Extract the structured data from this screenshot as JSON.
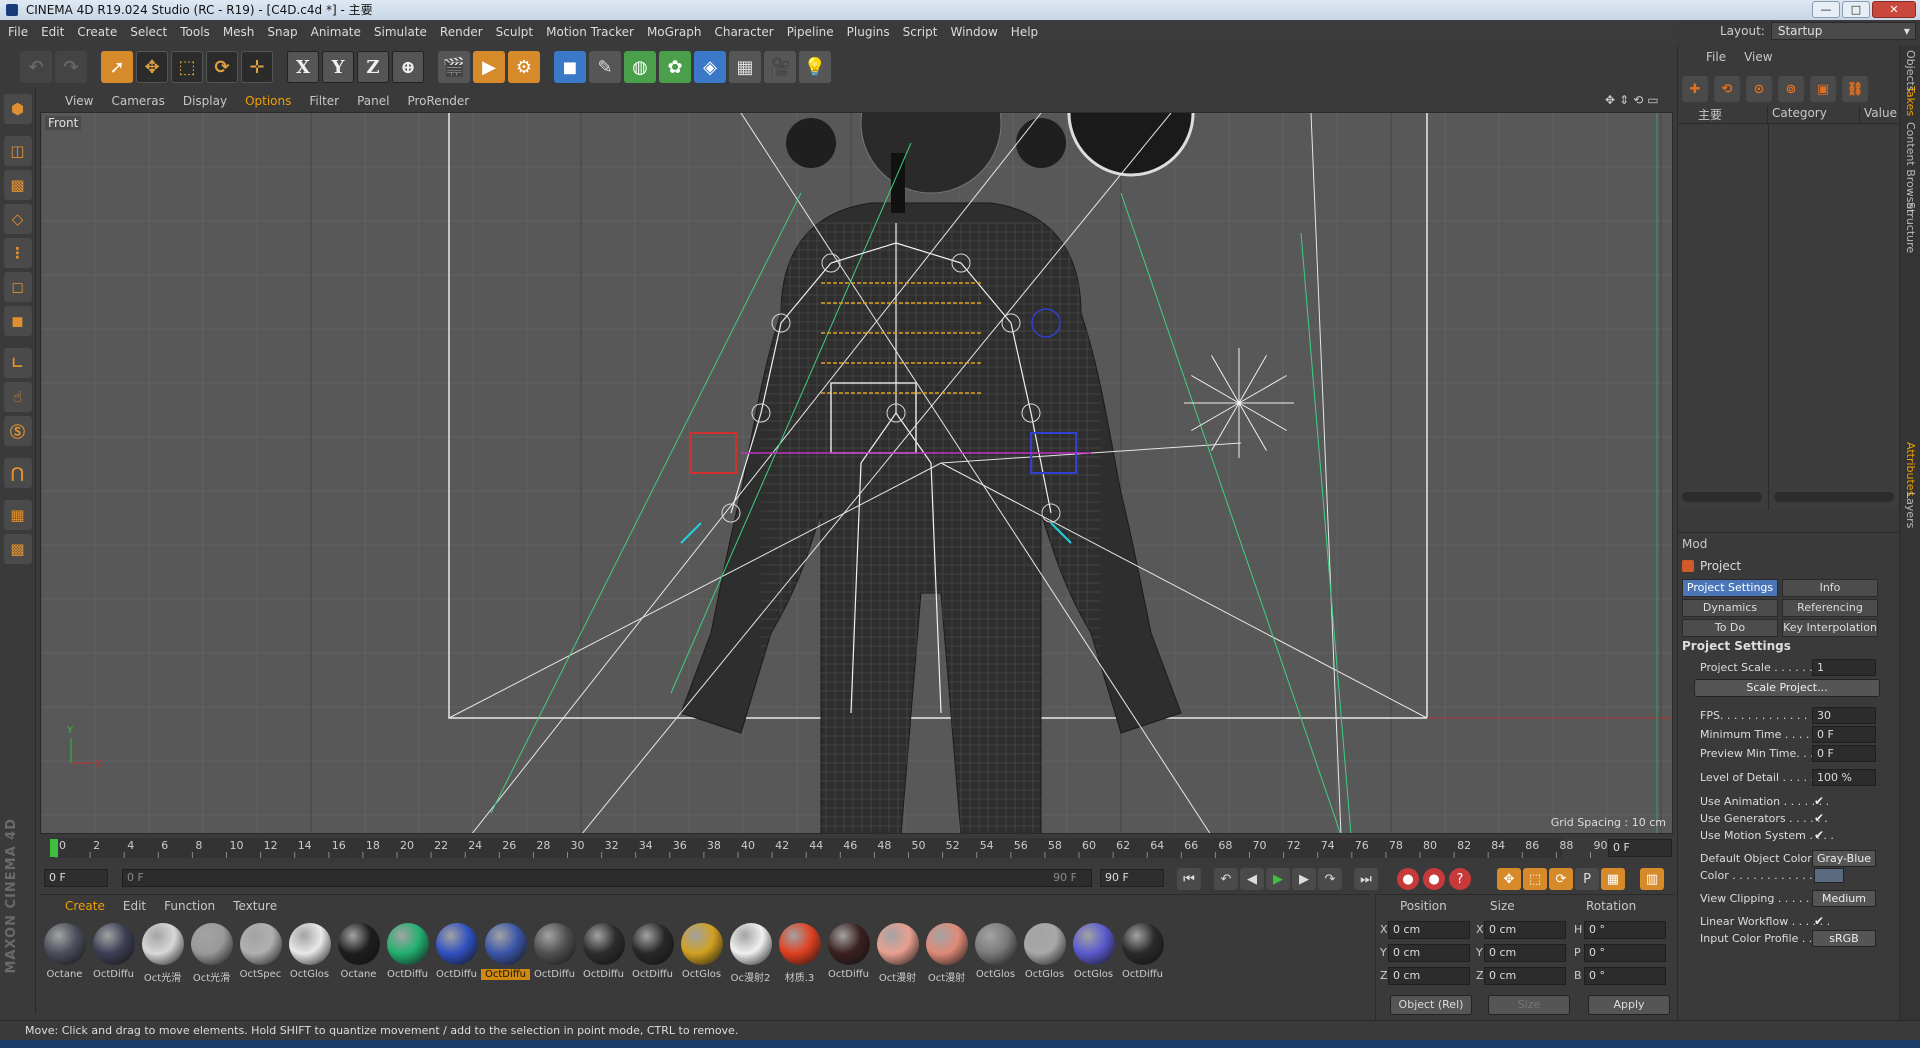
{
  "window": {
    "title": "CINEMA 4D R19.024 Studio (RC - R19) - [C4D.c4d *] - 主要",
    "controls": [
      "—",
      "□",
      "✕"
    ]
  },
  "menubar": [
    "File",
    "Edit",
    "Create",
    "Select",
    "Tools",
    "Mesh",
    "Snap",
    "Animate",
    "Simulate",
    "Render",
    "Sculpt",
    "Motion Tracker",
    "MoGraph",
    "Character",
    "Pipeline",
    "Plugins",
    "Script",
    "Window",
    "Help"
  ],
  "layout": {
    "label": "Layout:",
    "value": "Startup"
  },
  "viewport": {
    "menu": [
      "View",
      "Cameras",
      "Display",
      "Options",
      "Filter",
      "Panel",
      "ProRender"
    ],
    "active_menu": "Options",
    "name": "Front",
    "grid_spacing": "Grid Spacing : 10 cm",
    "axis_labels": {
      "y": "Y",
      "x": "X"
    }
  },
  "timeline": {
    "ticks": [
      "0",
      "2",
      "4",
      "6",
      "8",
      "10",
      "12",
      "14",
      "16",
      "18",
      "20",
      "22",
      "24",
      "26",
      "28",
      "30",
      "32",
      "34",
      "36",
      "38",
      "40",
      "42",
      "44",
      "46",
      "48",
      "50",
      "52",
      "54",
      "56",
      "58",
      "60",
      "62",
      "64",
      "66",
      "68",
      "70",
      "72",
      "74",
      "76",
      "78",
      "80",
      "82",
      "84",
      "86",
      "88",
      "90"
    ],
    "current_frame": "0 F",
    "start_frame": "0 F",
    "slider_start": "0 F",
    "slider_end": "90 F",
    "end_frame": "90 F"
  },
  "material_menu": [
    "Create",
    "Edit",
    "Function",
    "Texture"
  ],
  "material_menu_active": "Create",
  "materials": [
    {
      "name": "Octane",
      "color": "#4a4e5a"
    },
    {
      "name": "OctDiffu",
      "color": "#3c3f55"
    },
    {
      "name": "Oct光滑",
      "color": "#d8d8d8"
    },
    {
      "name": "Oct光滑",
      "color": "#9a9a9a"
    },
    {
      "name": "OctSpec",
      "color": "#b0b0b0"
    },
    {
      "name": "OctGlos",
      "color": "#e8e8e8"
    },
    {
      "name": "Octane",
      "color": "#1e1e1e"
    },
    {
      "name": "OctDiffu",
      "color": "#22b070"
    },
    {
      "name": "OctDiffu",
      "color": "#3050c0"
    },
    {
      "name": "OctDiffu",
      "color": "#3a56a8"
    },
    {
      "name": "OctDiffu",
      "color": "#505050"
    },
    {
      "name": "OctDiffu",
      "color": "#2c2c2c"
    },
    {
      "name": "OctDiffu",
      "color": "#282828"
    },
    {
      "name": "OctGlos",
      "color": "#d0a020"
    },
    {
      "name": "Oc漫射2",
      "color": "#f0f0f0"
    },
    {
      "name": "材质.3",
      "color": "#e04020"
    },
    {
      "name": "OctDiffu",
      "color": "#3a2020"
    },
    {
      "name": "Oct漫射",
      "color": "#e8a090"
    },
    {
      "name": "Oct漫射",
      "color": "#e08a78"
    },
    {
      "name": "OctGlos",
      "color": "#7a7a7a"
    },
    {
      "name": "OctGlos",
      "color": "#a8a8a8"
    },
    {
      "name": "OctGlos",
      "color": "#5a5ad0"
    },
    {
      "name": "OctDiffu",
      "color": "#2a2a2a"
    }
  ],
  "selected_material_index": 9,
  "coords": {
    "headers": [
      "Position",
      "Size",
      "Rotation"
    ],
    "rows": [
      {
        "axis": "X",
        "pos": "0 cm",
        "size_axis": "X",
        "size": "0 cm",
        "rot_axis": "H",
        "rot": "0 °"
      },
      {
        "axis": "Y",
        "pos": "0 cm",
        "size_axis": "Y",
        "size": "0 cm",
        "rot_axis": "P",
        "rot": "0 °"
      },
      {
        "axis": "Z",
        "pos": "0 cm",
        "size_axis": "Z",
        "size": "0 cm",
        "rot_axis": "B",
        "rot": "0 °"
      }
    ],
    "mode": "Object (Rel)",
    "size_mode": "Size",
    "apply": "Apply"
  },
  "status": "Move: Click and drag to move elements. Hold SHIFT to quantize movement / add to the selection in point mode, CTRL to remove.",
  "objects": {
    "menu": [
      "File",
      "View"
    ],
    "columns": [
      "主要",
      "Category",
      "Value"
    ]
  },
  "attributes": {
    "mode": "Mod",
    "object": "Project",
    "tabs": [
      "Project Settings",
      "Info",
      "Dynamics",
      "Referencing",
      "To Do",
      "Key Interpolation"
    ],
    "active_tab": "Project Settings",
    "section": "Project Settings",
    "scale_button": "Scale Project...",
    "rows": [
      {
        "k": "Project Scale . . . . . . .",
        "v": "1",
        "t": "field"
      },
      {
        "k": "FPS. . . . . . . . . . . . . . .",
        "v": "30",
        "t": "field"
      },
      {
        "k": "Minimum Time . . . . . . .",
        "v": "0 F",
        "t": "field"
      },
      {
        "k": "Preview Min Time. . . . .",
        "v": "0 F",
        "t": "field"
      },
      {
        "k": "Level of Detail . . . . . .",
        "v": "100 %",
        "t": "field"
      },
      {
        "k": "Use Animation . . . . . . .",
        "v": "✔",
        "t": "check"
      },
      {
        "k": "Use Generators . . . . . .",
        "v": "✔",
        "t": "check"
      },
      {
        "k": "Use Motion System . . . .",
        "v": "✔",
        "t": "check"
      },
      {
        "k": "Default Object Color",
        "v": "Gray-Blue",
        "t": "select"
      },
      {
        "k": "Color . . . . . . . . . . . .",
        "v": "",
        "t": "swatch"
      },
      {
        "k": "View Clipping . . . . . . .",
        "v": "Medium",
        "t": "select"
      },
      {
        "k": "Linear Workflow . . . . . .",
        "v": "✔",
        "t": "check"
      },
      {
        "k": "Input Color Profile . . .",
        "v": "sRGB",
        "t": "select"
      }
    ]
  },
  "side_tabs": [
    "Objects",
    "Takes",
    "Content Browser",
    "Structure",
    "Attributes",
    "Layers"
  ],
  "side_tabs_active": [
    "Takes",
    "Attributes"
  ],
  "maxon": "MAXON CINEMA 4D",
  "colors": {
    "accent": "#f0a000",
    "selected_tab": "#4a76b8",
    "viewport_bg": "#585858"
  }
}
